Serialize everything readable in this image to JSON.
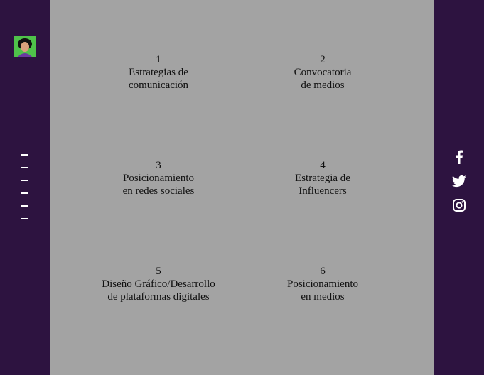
{
  "colors": {
    "sidebar": "#2d1340",
    "content": "#a3a3a3",
    "icon": "#ffffff",
    "avatar_bg": "#4fc24a"
  },
  "sidebar": {
    "avatar_icon": "avatar-image",
    "menu_icons": [
      "dash-icon",
      "dash-icon",
      "dash-icon",
      "dash-icon",
      "dash-icon",
      "dash-icon"
    ]
  },
  "social": [
    "facebook-icon",
    "twitter-icon",
    "instagram-icon"
  ],
  "items": [
    {
      "number": "1",
      "line1": "Estrategias de",
      "line2": "comunicación"
    },
    {
      "number": "2",
      "line1": "Convocatoria",
      "line2": "de medios"
    },
    {
      "number": "3",
      "line1": "Posicionamiento",
      "line2": "en redes sociales"
    },
    {
      "number": "4",
      "line1": "Estrategia de",
      "line2": "Influencers"
    },
    {
      "number": "5",
      "line1": "Diseño Gráfico/Desarrollo",
      "line2": "de plataformas digitales"
    },
    {
      "number": "6",
      "line1": "Posicionamiento",
      "line2": "en medios"
    }
  ]
}
